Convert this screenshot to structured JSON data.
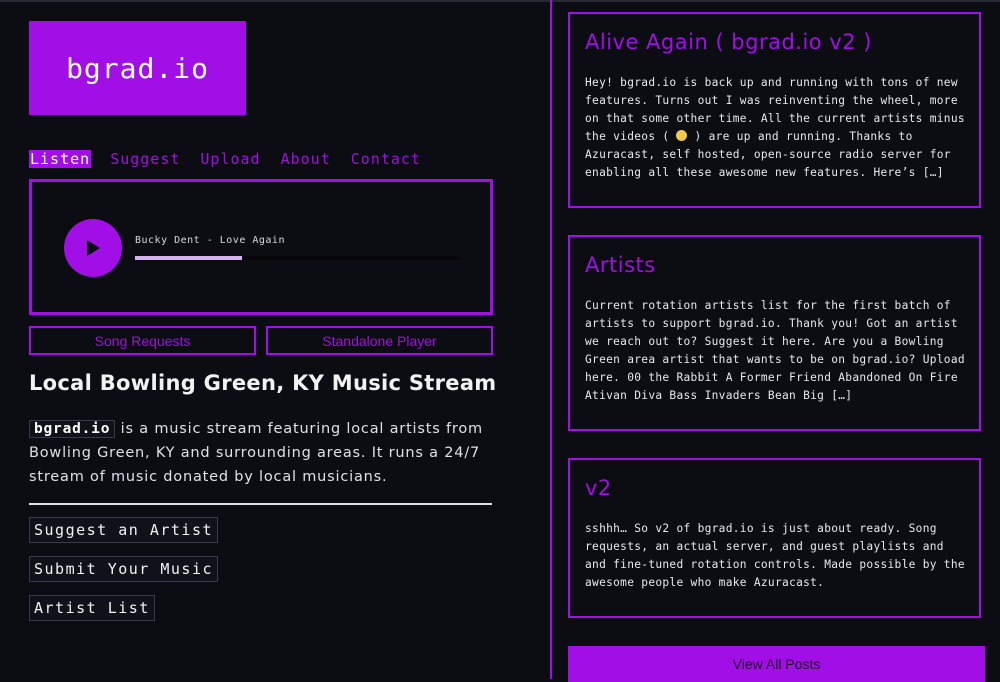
{
  "logo": {
    "text": "bgrad.io"
  },
  "nav": {
    "items": [
      {
        "label": "Listen",
        "active": true
      },
      {
        "label": "Suggest",
        "active": false
      },
      {
        "label": "Upload",
        "active": false
      },
      {
        "label": "About",
        "active": false
      },
      {
        "label": "Contact",
        "active": false
      }
    ]
  },
  "player": {
    "track": "Bucky Dent - Love Again",
    "progress_fraction": 0.33,
    "accent": "#a20ee6"
  },
  "buttons": {
    "song_requests": "Song Requests",
    "standalone_player": "Standalone Player"
  },
  "main": {
    "heading": "Local Bowling Green, KY Music Stream",
    "desc_code": "bgrad.io",
    "desc_text": " is a music stream featuring local artists from Bowling Green, KY and surrounding areas. It runs a 24/7 stream of music donated by local musicians.",
    "links": [
      "Suggest an Artist",
      "Submit Your Music",
      "Artist List"
    ]
  },
  "posts": [
    {
      "title": "Alive Again ( bgrad.io v2 )",
      "body_before_emoji": "Hey! bgrad.io is back up and running with tons of new features. Turns out I was reinventing the wheel, more on that some other time. All the current artists minus the videos ( ",
      "body_after_emoji": " ) are up and running. Thanks to Azuracast, self hosted, open-source radio server for enabling all these awesome new features. Here’s […]"
    },
    {
      "title": "Artists",
      "body": "Current rotation artists list for the first batch of artists to support bgrad.io. Thank you! Got an artist we reach out to? Suggest it here. Are you a Bowling Green area artist that wants to be on bgrad.io? Upload here. 00 the Rabbit A Former Friend Abandoned On Fire Ativan Diva Bass Invaders Bean Big […]"
    },
    {
      "title": "v2",
      "body": "sshhh… So v2 of bgrad.io is just about ready. Song requests, an actual server, and guest playlists and and fine-tuned rotation controls. Made possible by the awesome people who make Azuracast."
    }
  ],
  "view_all": "View All Posts"
}
